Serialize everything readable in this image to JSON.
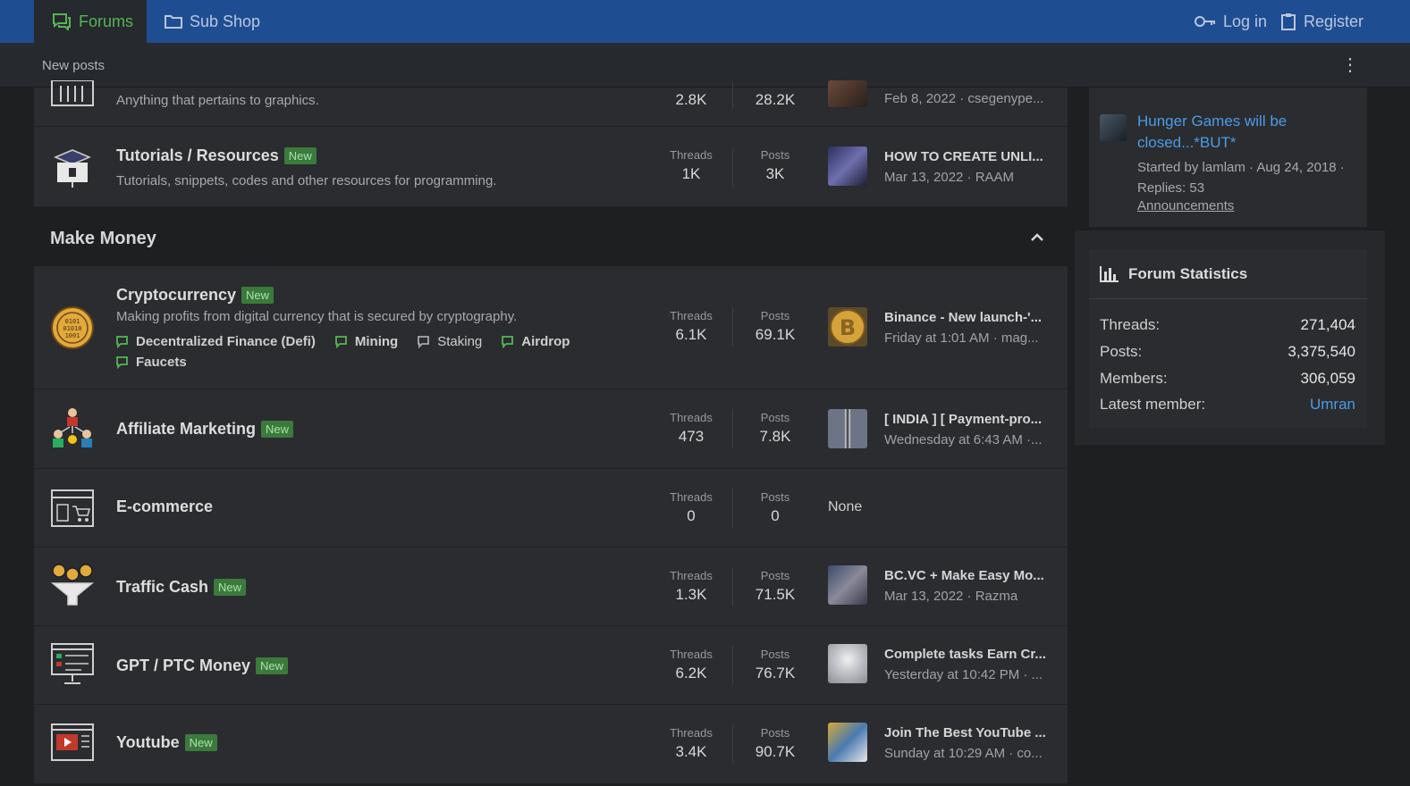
{
  "nav": {
    "tabs": [
      {
        "label": "Forums",
        "icon": "forum-icon"
      },
      {
        "label": "Sub Shop",
        "icon": "folder-icon"
      }
    ],
    "login_label": "Log in",
    "register_label": "Register"
  },
  "subnav": {
    "new_posts": "New posts"
  },
  "forums_top": [
    {
      "title": "",
      "description": "Anything that pertains to graphics.",
      "threads": "2.8K",
      "posts": "28.2K",
      "latest_meta": "Feb 8, 2022 · csegenype..."
    },
    {
      "title": "Tutorials / Resources",
      "badge": "New",
      "description": "Tutorials, snippets, codes and other resources for programming.",
      "threads_label": "Threads",
      "posts_label": "Posts",
      "threads": "1K",
      "posts": "3K",
      "latest_title": "HOW TO CREATE UNLI...",
      "latest_meta": "Mar 13, 2022 · RAAM"
    }
  ],
  "category": {
    "title": "Make Money"
  },
  "forums": [
    {
      "title": "Cryptocurrency",
      "badge": "New",
      "description": "Making profits from digital currency that is secured by cryptography.",
      "subforums": [
        "Decentralized Finance (Defi)",
        "Mining",
        "Staking",
        "Airdrop",
        "Faucets"
      ],
      "threads_label": "Threads",
      "posts_label": "Posts",
      "threads": "6.1K",
      "posts": "69.1K",
      "latest_title": "Binance - New launch-'...",
      "latest_meta": "Friday at 1:01 AM · mag..."
    },
    {
      "title": "Affiliate Marketing",
      "badge": "New",
      "threads_label": "Threads",
      "posts_label": "Posts",
      "threads": "473",
      "posts": "7.8K",
      "latest_title": "[ INDIA ] [ Payment-pro...",
      "latest_meta": "Wednesday at 6:43 AM ·..."
    },
    {
      "title": "E-commerce",
      "threads_label": "Threads",
      "posts_label": "Posts",
      "threads": "0",
      "posts": "0",
      "latest_none": "None"
    },
    {
      "title": "Traffic Cash",
      "badge": "New",
      "threads_label": "Threads",
      "posts_label": "Posts",
      "threads": "1.3K",
      "posts": "71.5K",
      "latest_title": "BC.VC + Make Easy Mo...",
      "latest_meta": "Mar 13, 2022 · Razma"
    },
    {
      "title": "GPT / PTC Money",
      "badge": "New",
      "threads_label": "Threads",
      "posts_label": "Posts",
      "threads": "6.2K",
      "posts": "76.7K",
      "latest_title": "Complete tasks Earn Cr...",
      "latest_meta": "Yesterday at 10:42 PM · ..."
    },
    {
      "title": "Youtube",
      "badge": "New",
      "threads_label": "Threads",
      "posts_label": "Posts",
      "threads": "3.4K",
      "posts": "90.7K",
      "latest_title": "Join The Best YouTube ...",
      "latest_meta": "Sunday at 10:29 AM · co..."
    }
  ],
  "sidebar": {
    "thread": {
      "title": "Hunger Games will be closed...*BUT*",
      "meta": "Started by lamlam · Aug 24, 2018 · Replies: 53",
      "forum": "Announcements"
    },
    "stats": {
      "title": "Forum Statistics",
      "rows": [
        {
          "label": "Threads:",
          "value": "271,404"
        },
        {
          "label": "Posts:",
          "value": "3,375,540"
        },
        {
          "label": "Members:",
          "value": "306,059"
        },
        {
          "label": "Latest member:",
          "value": "Umran"
        }
      ]
    }
  },
  "colors": {
    "nav": "#1f4d92",
    "accent_green": "#55b556",
    "link_blue": "#4b9ce8",
    "badge_bg": "#3b7a3c"
  }
}
